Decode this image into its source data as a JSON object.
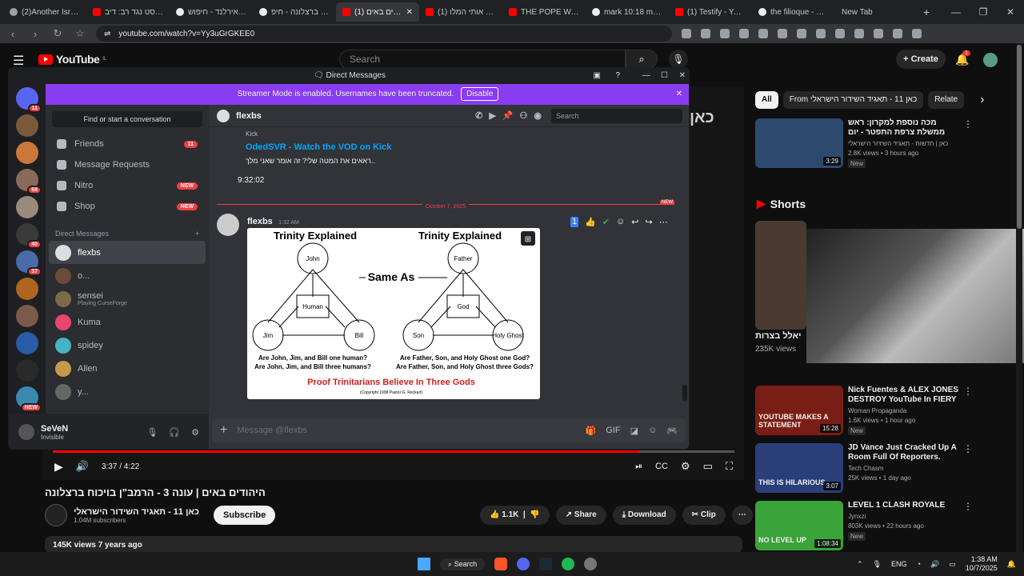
{
  "browser": {
    "tabs": [
      {
        "label": "(2)Another Israeli",
        "fav": "x"
      },
      {
        "label": "אתאיסט נגד רב: דיב",
        "fav": "yt"
      },
      {
        "label": "צפון אירלנד - חיפוש",
        "fav": "g"
      },
      {
        "label": "ויכוח ברצלונה - חיפ",
        "fav": "g"
      },
      {
        "label": "(1) היהודים באים",
        "fav": "yt",
        "active": true
      },
      {
        "label": "(1) שכנע אותי המלו",
        "fav": "yt"
      },
      {
        "label": "THE POPE WASH FI",
        "fav": "yt"
      },
      {
        "label": "mark 10:18 meanin",
        "fav": "g"
      },
      {
        "label": "(1) Testify - YouTub",
        "fav": "yt"
      },
      {
        "label": "the filioque - חיפוש ב",
        "fav": "g"
      },
      {
        "label": "New Tab",
        "fav": "none"
      }
    ],
    "url": "youtube.com/watch?v=Yy3uGrGKEE0"
  },
  "youtube": {
    "logo_text": "YouTube",
    "logo_super": "IL",
    "search_placeholder": "Search",
    "create_label": "Create",
    "notif_count": "1",
    "video_time": "3:37 / 4:22",
    "progress": 0.86,
    "video_title": "היהודים באים | עונה 3 - הרמב\"ן בויכוח ברצלונה",
    "channel_name": "כאן 11 - תאגיד השידור הישראלי",
    "subscribers": "1.04M subscribers",
    "subscribe_label": "Subscribe",
    "likes": "1.1K",
    "share_label": "Share",
    "download_label": "Download",
    "clip_label": "Clip",
    "views_line": "145K views  7 years ago",
    "chips": [
      "All",
      "From כאן 11 - תאגיד השידור הישראלי",
      "Relate"
    ],
    "recs_top": [
      {
        "title": "מכה נוספת למקרון: ראש ממשלת צרפת התפטר - יום אחרי שהציג את",
        "channel": "כאן | חדשות - תאגיד השידור הישראלי",
        "views": "2.8K views • 3 hours ago",
        "dur": "3:29",
        "badge": "New",
        "color": "#2d4a6e"
      }
    ],
    "shorts_label": "Shorts",
    "short_title": "יאלל בצרות",
    "short_views": "235K views",
    "recs_bottom": [
      {
        "title": "Nick Fuentes & ALEX JONES DESTROY YouTube In FIERY ...",
        "channel": "Woman Propaganda",
        "views": "1.6K views • 1 hour ago",
        "dur": "15:28",
        "badge": "New",
        "color": "#7a1d14",
        "thumbtext": "YOUTUBE MAKES A STATEMENT"
      },
      {
        "title": "JD Vance Just Cracked Up A Room Full Of Reporters.",
        "channel": "Tech Chasm",
        "views": "25K views • 1 day ago",
        "dur": "3:07",
        "badge": "",
        "color": "#2a3f7a",
        "thumbtext": "THIS IS HILARIOUS"
      },
      {
        "title": "LEVEL 1 CLASH ROYALE",
        "channel": "Jynxzi",
        "views": "803K views • 22 hours ago",
        "dur": "1:08:34",
        "badge": "New",
        "color": "#3aa33a",
        "thumbtext": "NO LEVEL UP"
      }
    ]
  },
  "discord": {
    "window_title": "Direct Messages",
    "streamer_text": "Streamer Mode is enabled. Usernames have been truncated.",
    "disable_label": "Disable",
    "guild_badges": [
      "11",
      "",
      "",
      "68",
      "",
      "40",
      "37",
      "",
      "",
      "",
      "",
      "NEW"
    ],
    "find_conv": "Find or start a conversation",
    "nav": [
      {
        "label": "Friends",
        "badge": "11",
        "kind": "count"
      },
      {
        "label": "Message Requests",
        "badge": "",
        "kind": ""
      },
      {
        "label": "Nitro",
        "badge": "NEW",
        "kind": "new"
      },
      {
        "label": "Shop",
        "badge": "NEW",
        "kind": "new"
      }
    ],
    "dm_header": "Direct Messages",
    "dms": [
      {
        "name": "flexbs",
        "sub": "",
        "color": "#ddd",
        "sel": true
      },
      {
        "name": "o...",
        "sub": "",
        "color": "#6b4a3a"
      },
      {
        "name": "sensei",
        "sub": "Playing CurseForge",
        "color": "#7a6a4a"
      },
      {
        "name": "Kuma",
        "sub": "",
        "color": "#e8466e"
      },
      {
        "name": "spidey",
        "sub": "",
        "color": "#46b3c4"
      },
      {
        "name": "Allen",
        "sub": "",
        "color": "#c49a46"
      },
      {
        "name": "y...",
        "sub": "",
        "color": "#666"
      }
    ],
    "user_name": "SeVeN",
    "user_status": "Invisible",
    "chat_name": "flexbs",
    "search_placeholder": "Search",
    "embed_provider": "Kick",
    "embed_link": "OdedSVR - Watch the VOD on Kick",
    "embed_desc": "..ראאים את המטה שלי? זה אומר שאני מלך",
    "embed_time": "9:32:02",
    "date_sep": "October 7, 2025",
    "date_new": "NEW",
    "msg_author": "flexbs",
    "msg_time": "1:32 AM",
    "composer_placeholder": "Message @flexbs",
    "image": {
      "left_title": "Trinity Explained",
      "right_title": "Trinity Explained",
      "same_as": "Same As",
      "left_nodes": [
        "John",
        "Human",
        "Jim",
        "Bill"
      ],
      "right_nodes": [
        "Father",
        "God",
        "Son",
        "Holy Ghost"
      ],
      "left_q1": "Are John, Jim, and Bill one human?",
      "left_q2": "Are John, Jim, and Bill three humans?",
      "right_q1": "Are Father, Son, and Holy Ghost one God?",
      "right_q2": "Are Father, Son, and Holy Ghost three Gods?",
      "proof": "Proof Trinitarians Believe In Three Gods",
      "copyright": "(Copyright 1998 Pastor G. Reckart)"
    }
  },
  "taskbar": {
    "search_label": "Search",
    "lang": "ENG",
    "time": "1:38 AM",
    "date": "10/7/2025"
  }
}
